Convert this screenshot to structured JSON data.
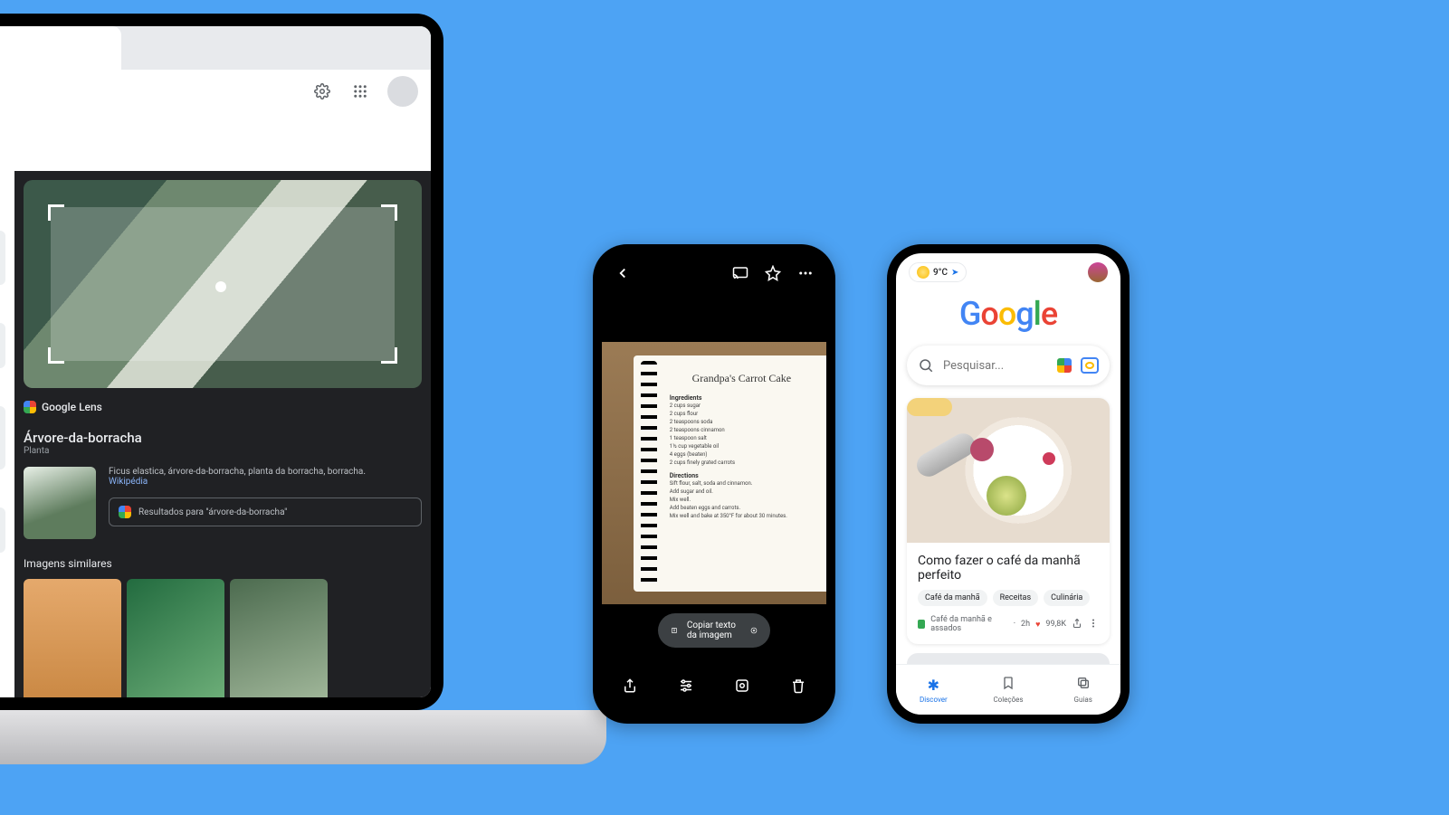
{
  "laptop": {
    "lens_brand": "Google Lens",
    "result_title": "Árvore-da-borracha",
    "result_subtitle": "Planta",
    "description": "Ficus elastica, árvore-da-borracha, planta da borracha, borracha.",
    "source_link": "Wikipédia",
    "results_button": "Resultados para \"árvore-da-borracha\"",
    "similar_heading": "Imagens similares"
  },
  "phone1": {
    "recipe_title": "Grandpa's Carrot Cake",
    "ingredients_h": "Ingredients",
    "ingredients": [
      "2 cups sugar",
      "2 cups flour",
      "2 teaspoons soda",
      "2 teaspoons cinnamon",
      "1 teaspoon salt",
      "1½ cup vegetable oil",
      "4 eggs (beaten)",
      "2 cups finely grated carrots"
    ],
    "directions_h": "Directions",
    "directions": [
      "Sift flour, salt, soda and cinnamon.",
      "Add sugar and oil.",
      "Mix well.",
      "Add beaten eggs and carrots.",
      "Mix well and bake at 350°F for about 30 minutes."
    ],
    "copy_pill": "Copiar texto da imagem"
  },
  "phone2": {
    "temperature": "9°C",
    "search_placeholder": "Pesquisar...",
    "card_title": "Como fazer o café da manhã perfeito",
    "chips": [
      "Café da manhã",
      "Receitas",
      "Culinária"
    ],
    "meta_source": "Café da manhã e assados",
    "meta_time": "2h",
    "meta_likes": "99,8K",
    "nav": {
      "discover": "Discover",
      "collections": "Coleções",
      "guides": "Guias"
    }
  }
}
